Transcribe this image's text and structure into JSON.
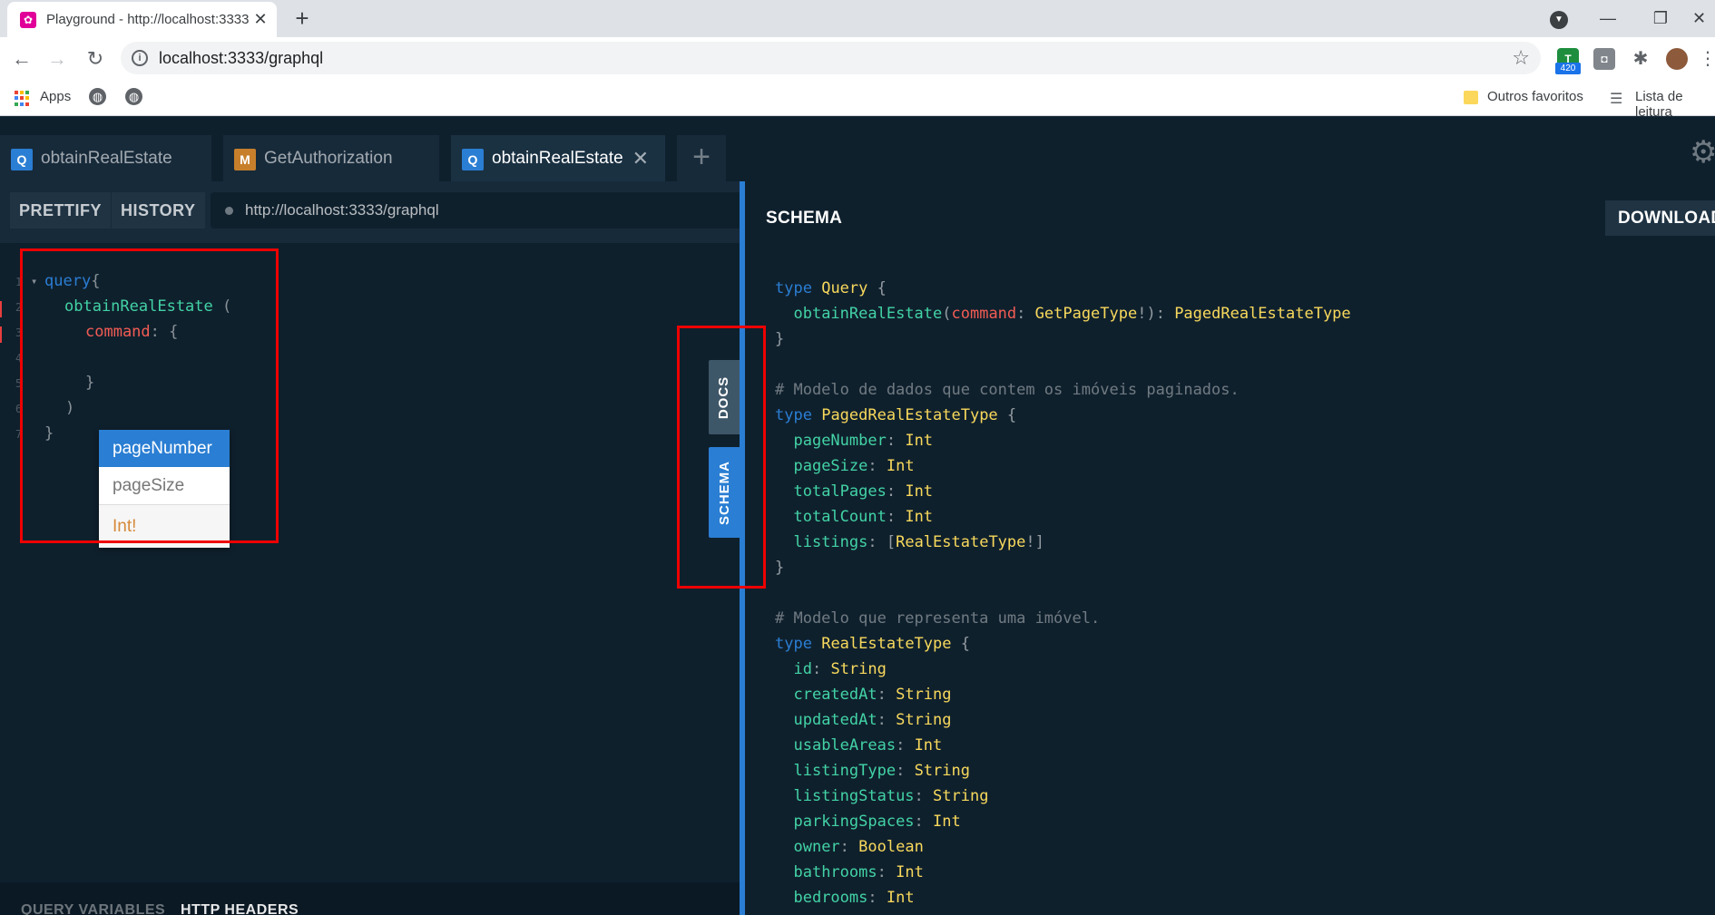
{
  "browser": {
    "tab_title": "Playground - http://localhost:3333",
    "tab_close": "✕",
    "new_tab": "+",
    "window": {
      "minimize": "—",
      "restore": "❐",
      "close": "✕"
    },
    "address": "localhost:3333/graphql",
    "extension_badge": "420",
    "bookmarks": {
      "apps": "Apps",
      "other_favorites": "Outros favoritos",
      "reading_list": "Lista de leitura"
    }
  },
  "playground": {
    "tabs": [
      {
        "badge": "Q",
        "label": "obtainRealEstate"
      },
      {
        "badge": "M",
        "label": "GetAuthorization"
      },
      {
        "badge": "Q",
        "label": "obtainRealEstate"
      }
    ],
    "add_tab": "+",
    "toolbar": {
      "prettify": "PRETTIFY",
      "history": "HISTORY",
      "endpoint": "http://localhost:3333/graphql"
    },
    "editor": {
      "line_numbers": [
        "1",
        "2",
        "3",
        "4",
        "5",
        "6",
        "7"
      ],
      "fold_marker": "▾",
      "line1_kw": "query",
      "line1_brace": "{",
      "line2_fn": "obtainRealEstate",
      "line2_paren": " (",
      "line3_arg": "command",
      "line3_rest": ": {",
      "line5": "}",
      "line6": ")",
      "line7": "}"
    },
    "autocomplete": {
      "options": [
        "pageNumber",
        "pageSize"
      ],
      "type": "Int!"
    },
    "side_tabs": {
      "docs": "DOCS",
      "schema": "SCHEMA"
    },
    "bottom": {
      "query_variables": "QUERY VARIABLES",
      "http_headers": "HTTP HEADERS"
    }
  },
  "schema_panel": {
    "title": "SCHEMA",
    "download": "DOWNLOAD",
    "query_type": {
      "kw": "type",
      "name": "Query",
      "field": "obtainRealEstate",
      "arg": "command",
      "arg_type": "GetPageType",
      "return_type": "PagedRealEstateType"
    },
    "comment1": "# Modelo de dados que contem os imóveis paginados.",
    "paged_type": {
      "name": "PagedRealEstateType",
      "fields": [
        {
          "name": "pageNumber",
          "type": "Int"
        },
        {
          "name": "pageSize",
          "type": "Int"
        },
        {
          "name": "totalPages",
          "type": "Int"
        },
        {
          "name": "totalCount",
          "type": "Int"
        }
      ],
      "listings_field": "listings",
      "listings_type": "RealEstateType"
    },
    "comment2": "# Modelo que representa uma imóvel.",
    "realestate_type": {
      "name": "RealEstateType",
      "fields": [
        {
          "name": "id",
          "type": "String"
        },
        {
          "name": "createdAt",
          "type": "String"
        },
        {
          "name": "updatedAt",
          "type": "String"
        },
        {
          "name": "usableAreas",
          "type": "Int"
        },
        {
          "name": "listingType",
          "type": "String"
        },
        {
          "name": "listingStatus",
          "type": "String"
        },
        {
          "name": "parkingSpaces",
          "type": "Int"
        },
        {
          "name": "owner",
          "type": "Boolean"
        },
        {
          "name": "bathrooms",
          "type": "Int"
        },
        {
          "name": "bedrooms",
          "type": "Int"
        }
      ]
    }
  },
  "colors": {
    "accent": "#2a7ed3",
    "highlight_box": "#e00000",
    "type_name": "#f8d95c",
    "field_name": "#42d3a5",
    "argument": "#f25c54"
  }
}
